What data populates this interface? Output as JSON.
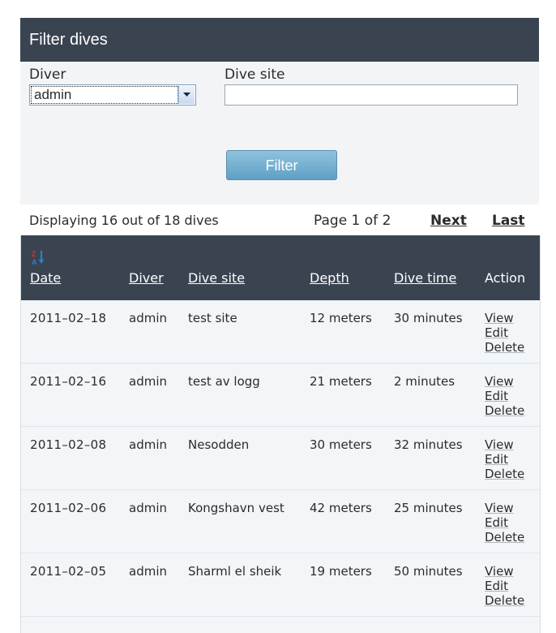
{
  "panel": {
    "title": "Filter dives",
    "diver_label": "Diver",
    "diver_value": "admin",
    "site_label": "Dive site",
    "site_value": "",
    "filter_button": "Filter"
  },
  "pager": {
    "count_text": "Displaying 16 out of 18 dives",
    "page_text": "Page 1 of 2",
    "next": "Next",
    "last": "Last"
  },
  "table": {
    "sort_icon": "sort-z-a-icon",
    "headers": {
      "date": "Date",
      "diver": "Diver",
      "site": "Dive site",
      "depth": "Depth",
      "time": "Dive time",
      "action": "Action"
    },
    "rows": [
      {
        "date": "2011–02–18",
        "diver": "admin",
        "site": "test site",
        "depth": "12 meters",
        "time": "30 minutes",
        "view": "View",
        "edit": "Edit",
        "delete": "Delete"
      },
      {
        "date": "2011–02–16",
        "diver": "admin",
        "site": "test av logg",
        "depth": "21 meters",
        "time": "2 minutes",
        "view": "View",
        "edit": "Edit",
        "delete": "Delete"
      },
      {
        "date": "2011–02–08",
        "diver": "admin",
        "site": "Nesodden",
        "depth": "30 meters",
        "time": "32 minutes",
        "view": "View",
        "edit": "Edit",
        "delete": "Delete"
      },
      {
        "date": "2011–02–06",
        "diver": "admin",
        "site": "Kongshavn vest",
        "depth": "42 meters",
        "time": "25 minutes",
        "view": "View",
        "edit": "Edit",
        "delete": "Delete"
      },
      {
        "date": "2011–02–05",
        "diver": "admin",
        "site": "Sharml el sheik",
        "depth": "19 meters",
        "time": "50 minutes",
        "view": "View",
        "edit": "Edit",
        "delete": "Delete"
      }
    ]
  },
  "colors": {
    "header_bg": "#3a4451",
    "panel_bg": "#f2f4f6",
    "button_bg": "#6aaacd"
  }
}
